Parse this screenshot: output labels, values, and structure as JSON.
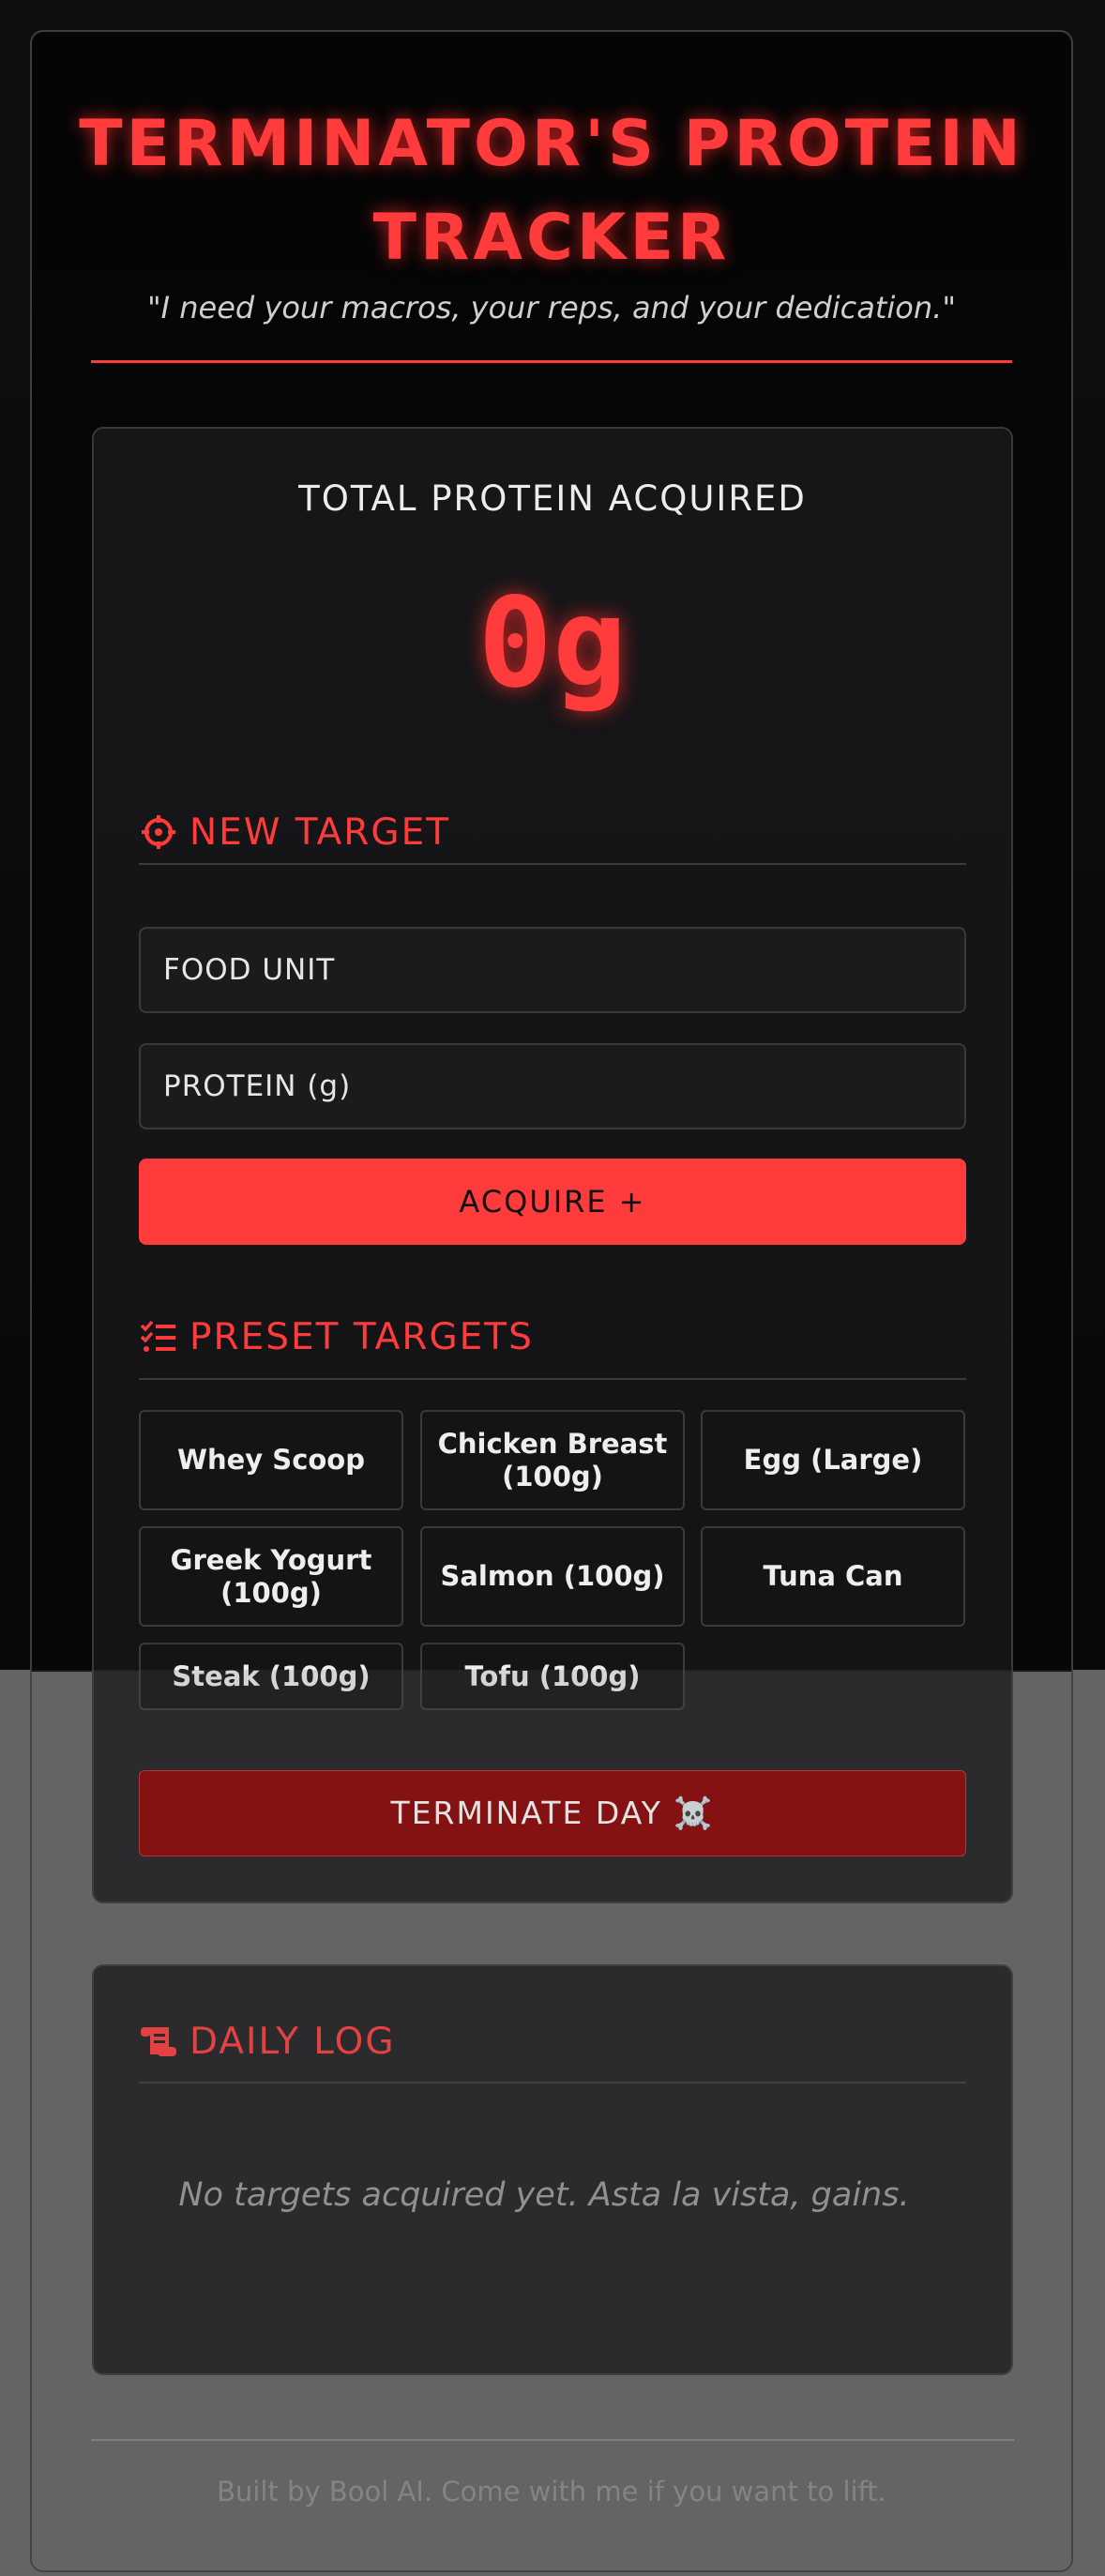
{
  "header": {
    "title": "TERMINATOR'S PROTEIN TRACKER",
    "subtitle": "\"I need your macros, your reps, and your dedication.\""
  },
  "total": {
    "label": "TOTAL PROTEIN ACQUIRED",
    "value": "0g"
  },
  "new_target": {
    "heading": "NEW TARGET",
    "icon": "crosshair-icon",
    "food_placeholder": "FOOD UNIT",
    "protein_placeholder": "PROTEIN (g)",
    "acquire_label": "ACQUIRE +"
  },
  "presets": {
    "heading": "PRESET TARGETS",
    "icon": "checklist-icon",
    "items": [
      "Whey Scoop",
      "Chicken Breast (100g)",
      "Egg (Large)",
      "Greek Yogurt (100g)",
      "Salmon (100g)",
      "Tuna Can",
      "Steak (100g)",
      "Tofu (100g)"
    ]
  },
  "terminate": {
    "label": "TERMINATE DAY ☠️"
  },
  "log": {
    "heading": "DAILY LOG",
    "icon": "scroll-icon",
    "empty_message": "No targets acquired yet. Asta la vista, gains."
  },
  "footer": {
    "text": "Built by Bool AI. Come with me if you want to lift."
  },
  "colors": {
    "accent": "#ff3b3b",
    "danger": "#8b0000",
    "panel": "#161618"
  }
}
